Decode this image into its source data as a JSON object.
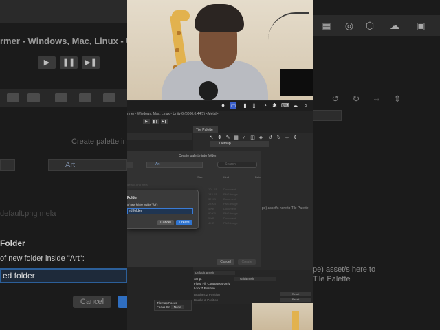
{
  "background": {
    "left_title": "rmer - Windows, Mac, Linux - U",
    "create_palette": "Create palette in",
    "location": "Art",
    "default_file": "default.png mela",
    "new_folder_heading": "Folder",
    "name_label": "of new folder inside \"Art\":",
    "name_value": "ed folder",
    "cancel": "Cancel",
    "right_hint": "pe) asset/s here to\nTile Palette"
  },
  "menubar": {
    "icons": [
      "screen-record-icon",
      "control-icon",
      "battery-icon",
      "wifi-icon",
      "dot-icon",
      "bluetooth-icon",
      "keyboard-icon",
      "cloud-icon",
      "search-icon"
    ]
  },
  "unity": {
    "window_title": "rmer - Windows, Mac, Linux - Unity 6 (6000.0.44f1) <Metal>",
    "tile_palette_tab": "Tile Palette",
    "active_tilemap": "Tilemap"
  },
  "dialog": {
    "title": "Create palette into folder",
    "location": "Art",
    "search_placeholder": "Search",
    "columns": [
      "Size",
      "Kind",
      "Date"
    ],
    "files": [
      {
        "name": "default.png mela",
        "size": "",
        "kind": "",
        "date": ""
      },
      {
        "name": "",
        "size": "101 KB",
        "kind": "Document",
        "date": ""
      },
      {
        "name": "",
        "size": "143 KB",
        "kind": "PNG image",
        "date": ""
      },
      {
        "name": "",
        "size": "32 KB",
        "kind": "Document",
        "date": ""
      },
      {
        "name": "",
        "size": "23 KB",
        "kind": "PNG image",
        "date": ""
      },
      {
        "name": "",
        "size": "4 KB",
        "kind": "Document",
        "date": ""
      },
      {
        "name": "",
        "size": "90 KB",
        "kind": "PNG image",
        "date": ""
      },
      {
        "name": "",
        "size": "5 KB",
        "kind": "Document",
        "date": ""
      },
      {
        "name": "",
        "size": "4 KB",
        "kind": "PNG image",
        "date": ""
      }
    ],
    "cancel": "Cancel",
    "create": "Create"
  },
  "new_folder": {
    "title": "Folder",
    "label": "of new folder inside \"Art\":",
    "value": "ed folder",
    "cancel": "Cancel",
    "create": "Create"
  },
  "drop_hint": "pe) asset/s here to Tile Palette",
  "inspector": {
    "default_brush": "Default Brush",
    "script_label": "Script",
    "script_value": "GridBrush",
    "flood_fill": "Flood Fill Contiguous Only",
    "lock_z": "Lock Z Position",
    "z_position": "Brushes Z Position",
    "z_position_2": "Brushs Z Position",
    "reset": "Reset"
  },
  "focus": {
    "title": "Tilemap Focus",
    "label": "Focus On",
    "value": "None"
  }
}
